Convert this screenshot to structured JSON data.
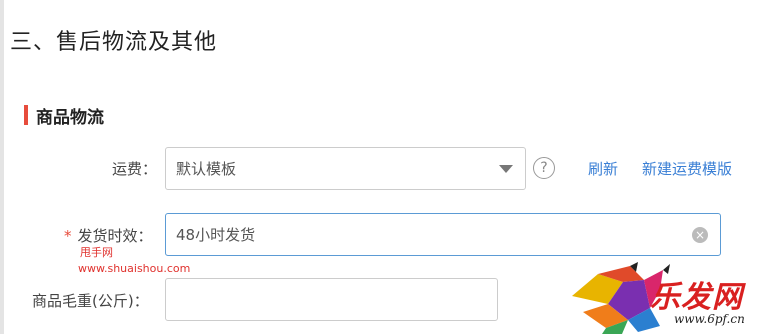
{
  "section": {
    "title": "三、售后物流及其他"
  },
  "subsection": {
    "title": "商品物流"
  },
  "shipping_fee": {
    "label": "运费：",
    "selected": "默认模板",
    "help_icon": "question-circle-icon",
    "refresh_link": "刷新",
    "new_template_link": "新建运费模版"
  },
  "delivery_time": {
    "required_mark": "*",
    "label": "发货时效：",
    "value": "48小时发货",
    "clear_icon": "clear-circle-icon"
  },
  "gross_weight": {
    "label": "商品毛重(公斤)：",
    "value": ""
  },
  "watermark": {
    "line1": "甩手网",
    "line2": "www.shuaishou.com"
  },
  "logo": {
    "text": "乐发网",
    "url": "www.6pf.cn"
  },
  "colors": {
    "accent_red": "#e74c3c",
    "link_blue": "#3a7fd5",
    "focus_border": "#5b9bd5"
  }
}
